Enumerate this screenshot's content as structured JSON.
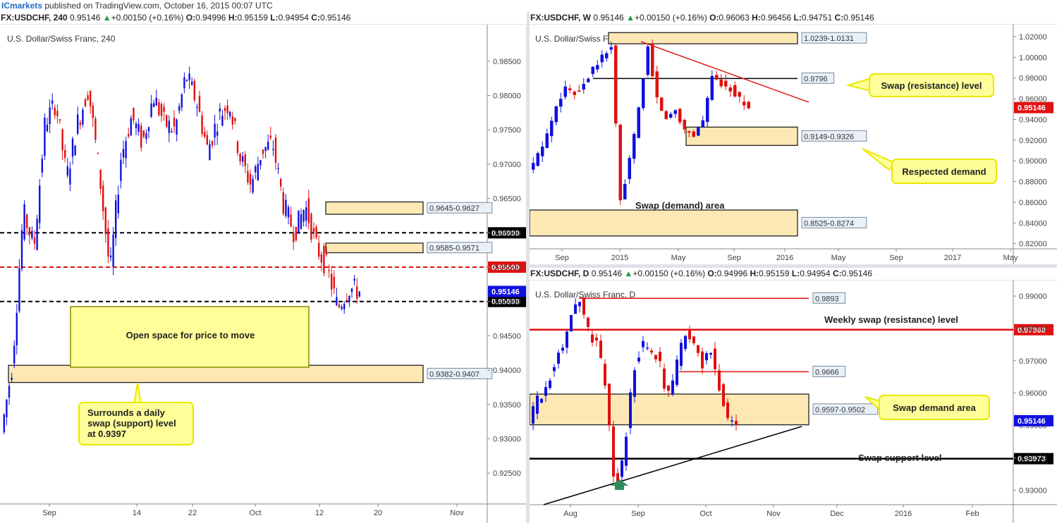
{
  "header": {
    "brand": "ICmarkets",
    "published": " published on TradingView.com, October 16, 2015 00:07 UTC"
  },
  "panels": {
    "h4": {
      "symbol": "FX:USDCHF, 240",
      "last": "0.95146",
      "change": "+0.00150 (+0.16%)",
      "o": "0.94996",
      "h": "0.95159",
      "l": "0.94954",
      "c": "0.95146",
      "label": "U.S. Dollar/Swiss Franc, 240"
    },
    "weekly": {
      "symbol": "FX:USDCHF, W",
      "last": "0.95146",
      "change": "+0.00150 (+0.16%)",
      "o": "0.96063",
      "h": "0.96456",
      "l": "0.94751",
      "c": "0.95146",
      "label": "U.S. Dollar/Swiss Franc, W"
    },
    "daily": {
      "symbol": "FX:USDCHF, D",
      "last": "0.95146",
      "change": "+0.00150 (+0.16%)",
      "o": "0.94996",
      "h": "0.95159",
      "l": "0.94954",
      "c": "0.95146",
      "label": "U.S. Dollar/Swiss Franc, D"
    }
  },
  "ohlc_labels": {
    "o": "O:",
    "h": "H:",
    "l": "L:",
    "c": "C:"
  },
  "colors": {
    "bull": "#1010e0",
    "bear": "#e01010",
    "zone_fill": "#fde8b4",
    "callout_fill": "#ffff99",
    "callout_border": "#e8e800",
    "trend": "#e02020",
    "price_tag": "#1010e0",
    "weekly_price_tag": "#e01010",
    "level_red": "#e01010",
    "level_black": "#000000"
  },
  "chart_data": [
    {
      "id": "h4",
      "type": "candlestick",
      "title": "U.S. Dollar/Swiss Franc, 240",
      "xlabel": "",
      "ylabel": "",
      "ylim": [
        0.9205,
        0.9895
      ],
      "x_ticks": [
        "Sep",
        "14",
        "22",
        "Oct",
        "12",
        "20",
        "Nov"
      ],
      "y_ticks": [
        "0.98500",
        "0.98000",
        "0.97500",
        "0.97000",
        "0.96500",
        "0.96000",
        "0.95500",
        "0.95000",
        "0.94500",
        "0.94000",
        "0.93500",
        "0.93000",
        "0.92500"
      ],
      "last_price": "0.95146",
      "levels": [
        {
          "value": 0.96,
          "label": "0.96000",
          "style": "dashed-black"
        },
        {
          "value": 0.955,
          "label": "0.95500",
          "style": "dashed-red"
        },
        {
          "value": 0.95,
          "label": "0.95000",
          "style": "dashed-black"
        }
      ],
      "zones": [
        {
          "top": 0.9645,
          "bottom": 0.9627,
          "label": "0.9645-0.9627"
        },
        {
          "top": 0.9585,
          "bottom": 0.9571,
          "label": "0.9585-0.9571"
        },
        {
          "top": 0.9407,
          "bottom": 0.9382,
          "label": "0.9382-0.9407"
        }
      ],
      "annotations": [
        "Open space for price to move",
        "Surrounds a daily swap (support) level at 0.9397"
      ],
      "anchors": [
        0.931,
        0.941,
        0.963,
        0.958,
        0.976,
        0.979,
        0.968,
        0.976,
        0.981,
        0.969,
        0.954,
        0.971,
        0.977,
        0.973,
        0.98,
        0.976,
        0.975,
        0.983,
        0.979,
        0.972,
        0.977,
        0.979,
        0.971,
        0.967,
        0.972,
        0.973,
        0.964,
        0.96,
        0.964,
        0.958,
        0.955,
        0.949,
        0.952,
        0.9515
      ]
    },
    {
      "id": "weekly",
      "type": "candlestick",
      "title": "U.S. Dollar/Swiss Franc, W",
      "xlabel": "",
      "ylabel": "",
      "ylim": [
        0.815,
        1.0275
      ],
      "x_ticks": [
        "Sep",
        "2015",
        "May",
        "Sep",
        "2016",
        "May",
        "Sep",
        "2017",
        "May"
      ],
      "y_ticks": [
        "1.02000",
        "1.00000",
        "0.98000",
        "0.96000",
        "0.94000",
        "0.92000",
        "0.90000",
        "0.88000",
        "0.86000",
        "0.84000",
        "0.82000"
      ],
      "last_price": "0.95146",
      "levels": [
        {
          "value": 0.9796,
          "label": "0.9796",
          "style": "solid-black"
        }
      ],
      "zones": [
        {
          "top": 1.0239,
          "bottom": 1.0131,
          "label": "1.0239-1.0131"
        },
        {
          "top": 0.9326,
          "bottom": 0.9149,
          "label": "0.9149-0.9326"
        },
        {
          "top": 0.8525,
          "bottom": 0.8274,
          "label": "0.8525-0.8274"
        }
      ],
      "annotations": [
        "Swap (resistance) level",
        "Respected demand",
        "Swap (demand) area"
      ],
      "anchors": [
        0.89,
        0.905,
        0.925,
        0.955,
        0.97,
        0.965,
        0.975,
        0.99,
        1.0,
        1.01,
        0.86,
        0.9,
        0.95,
        1.01,
        0.96,
        0.94,
        0.95,
        0.93,
        0.925,
        0.94,
        0.98,
        0.975,
        0.97,
        0.96,
        0.9515
      ]
    },
    {
      "id": "daily",
      "type": "candlestick",
      "title": "U.S. Dollar/Swiss Franc, D",
      "xlabel": "",
      "ylabel": "",
      "ylim": [
        0.9255,
        0.9935
      ],
      "x_ticks": [
        "Aug",
        "Sep",
        "Oct",
        "Nov",
        "Dec",
        "2016",
        "Feb"
      ],
      "y_ticks": [
        "0.99000",
        "0.98000",
        "0.97000",
        "0.96000",
        "0.95000",
        "0.94000",
        "0.93000"
      ],
      "last_price": "0.95146",
      "levels": [
        {
          "value": 0.9893,
          "label": "0.9893",
          "style": "solid-red"
        },
        {
          "value": 0.9796,
          "label": "0.97960",
          "style": "solid-red-bold"
        },
        {
          "value": 0.9666,
          "label": "0.9666",
          "style": "solid-red"
        },
        {
          "value": 0.93973,
          "label": "0.93973",
          "style": "solid-black-bold"
        }
      ],
      "zones": [
        {
          "top": 0.9597,
          "bottom": 0.9502,
          "label": "0.9597-0.9502"
        }
      ],
      "annotations": [
        "Weekly swap (resistance) level",
        "Swap demand area",
        "Swap support level"
      ],
      "anchors": [
        0.951,
        0.958,
        0.962,
        0.97,
        0.976,
        0.985,
        0.989,
        0.978,
        0.976,
        0.958,
        0.929,
        0.941,
        0.966,
        0.975,
        0.973,
        0.971,
        0.958,
        0.967,
        0.979,
        0.976,
        0.969,
        0.973,
        0.962,
        0.951,
        0.9515
      ]
    }
  ]
}
